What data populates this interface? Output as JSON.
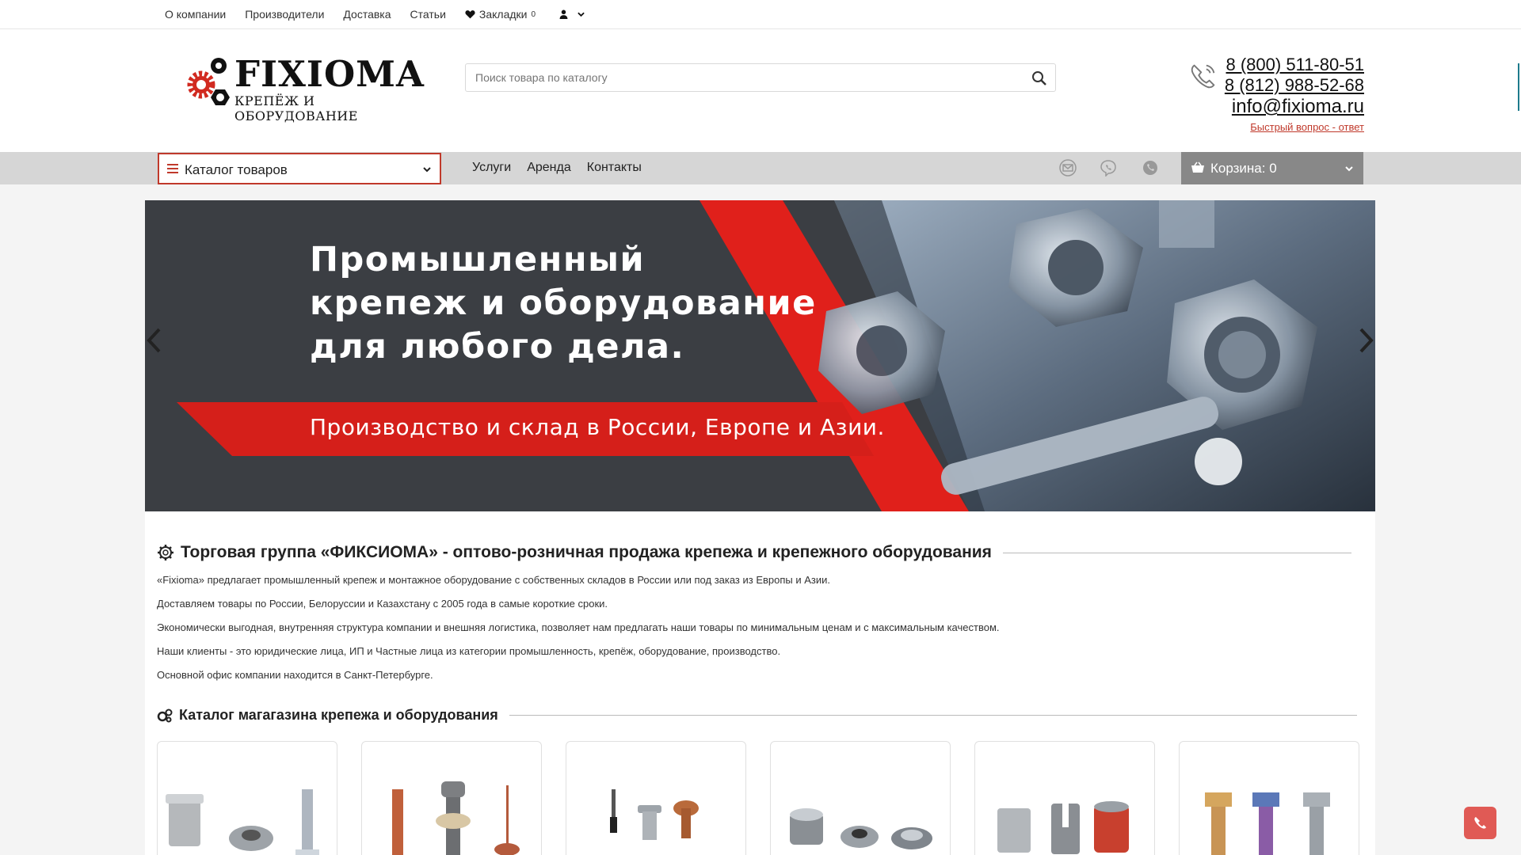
{
  "topbar": {
    "links": [
      "О компании",
      "Производители",
      "Доставка",
      "Статьи"
    ],
    "bookmarks_label": "Закладки",
    "bookmarks_count": "0"
  },
  "header": {
    "logo_word": "FIXIOMA",
    "logo_sub": "КРЕПЁЖ И ОБОРУДОВАНИЕ",
    "search_placeholder": "Поиск товара по каталогу",
    "phone1": "8 (800) 511-80-51",
    "phone2": "8 (812) 988-52-68",
    "email": "info@fixioma.ru",
    "quick_question": "Быстрый вопрос - ответ"
  },
  "nav": {
    "catalog_label": "Каталог товаров",
    "links": [
      "Услуги",
      "Аренда",
      "Контакты"
    ],
    "cart_label": "Корзина: 0"
  },
  "banner": {
    "headline": [
      "Промышленный",
      "крепеж и оборудование",
      "для любого дела."
    ],
    "subline": "Производство и склад в России, Европе и Азии."
  },
  "about": {
    "title": "Торговая группа «ФИКСИОМА» - оптово-розничная продажа крепежа и крепежного оборудования",
    "paragraphs": [
      "«Fixioma» предлагает промышленный крепеж и монтажное оборудование с собственных складов в России или под заказ из Европы и Азии.",
      "Доставляем товары по России, Белоруссии и Казахстану с 2005 года в самые короткие сроки.",
      "Экономически выгодная, внутренняя структура компании и внешняя логистика, позволяет нам предлагать наши товары по минимальным ценам и с максимальным качеством.",
      "Наши клиенты - это юридические лица, ИП и Частные лица из категории промышленность, крепёж, оборудование, производство.",
      "Основной офис компании находится в Санкт-Петербурге."
    ]
  },
  "catalog": {
    "title": "Каталог магагазина крепежа и оборудования"
  },
  "colors": {
    "accent_red": "#c0392b",
    "nav_gray": "#d6d6d6",
    "cart_gray": "#888888",
    "fab_red": "#e05a55"
  }
}
